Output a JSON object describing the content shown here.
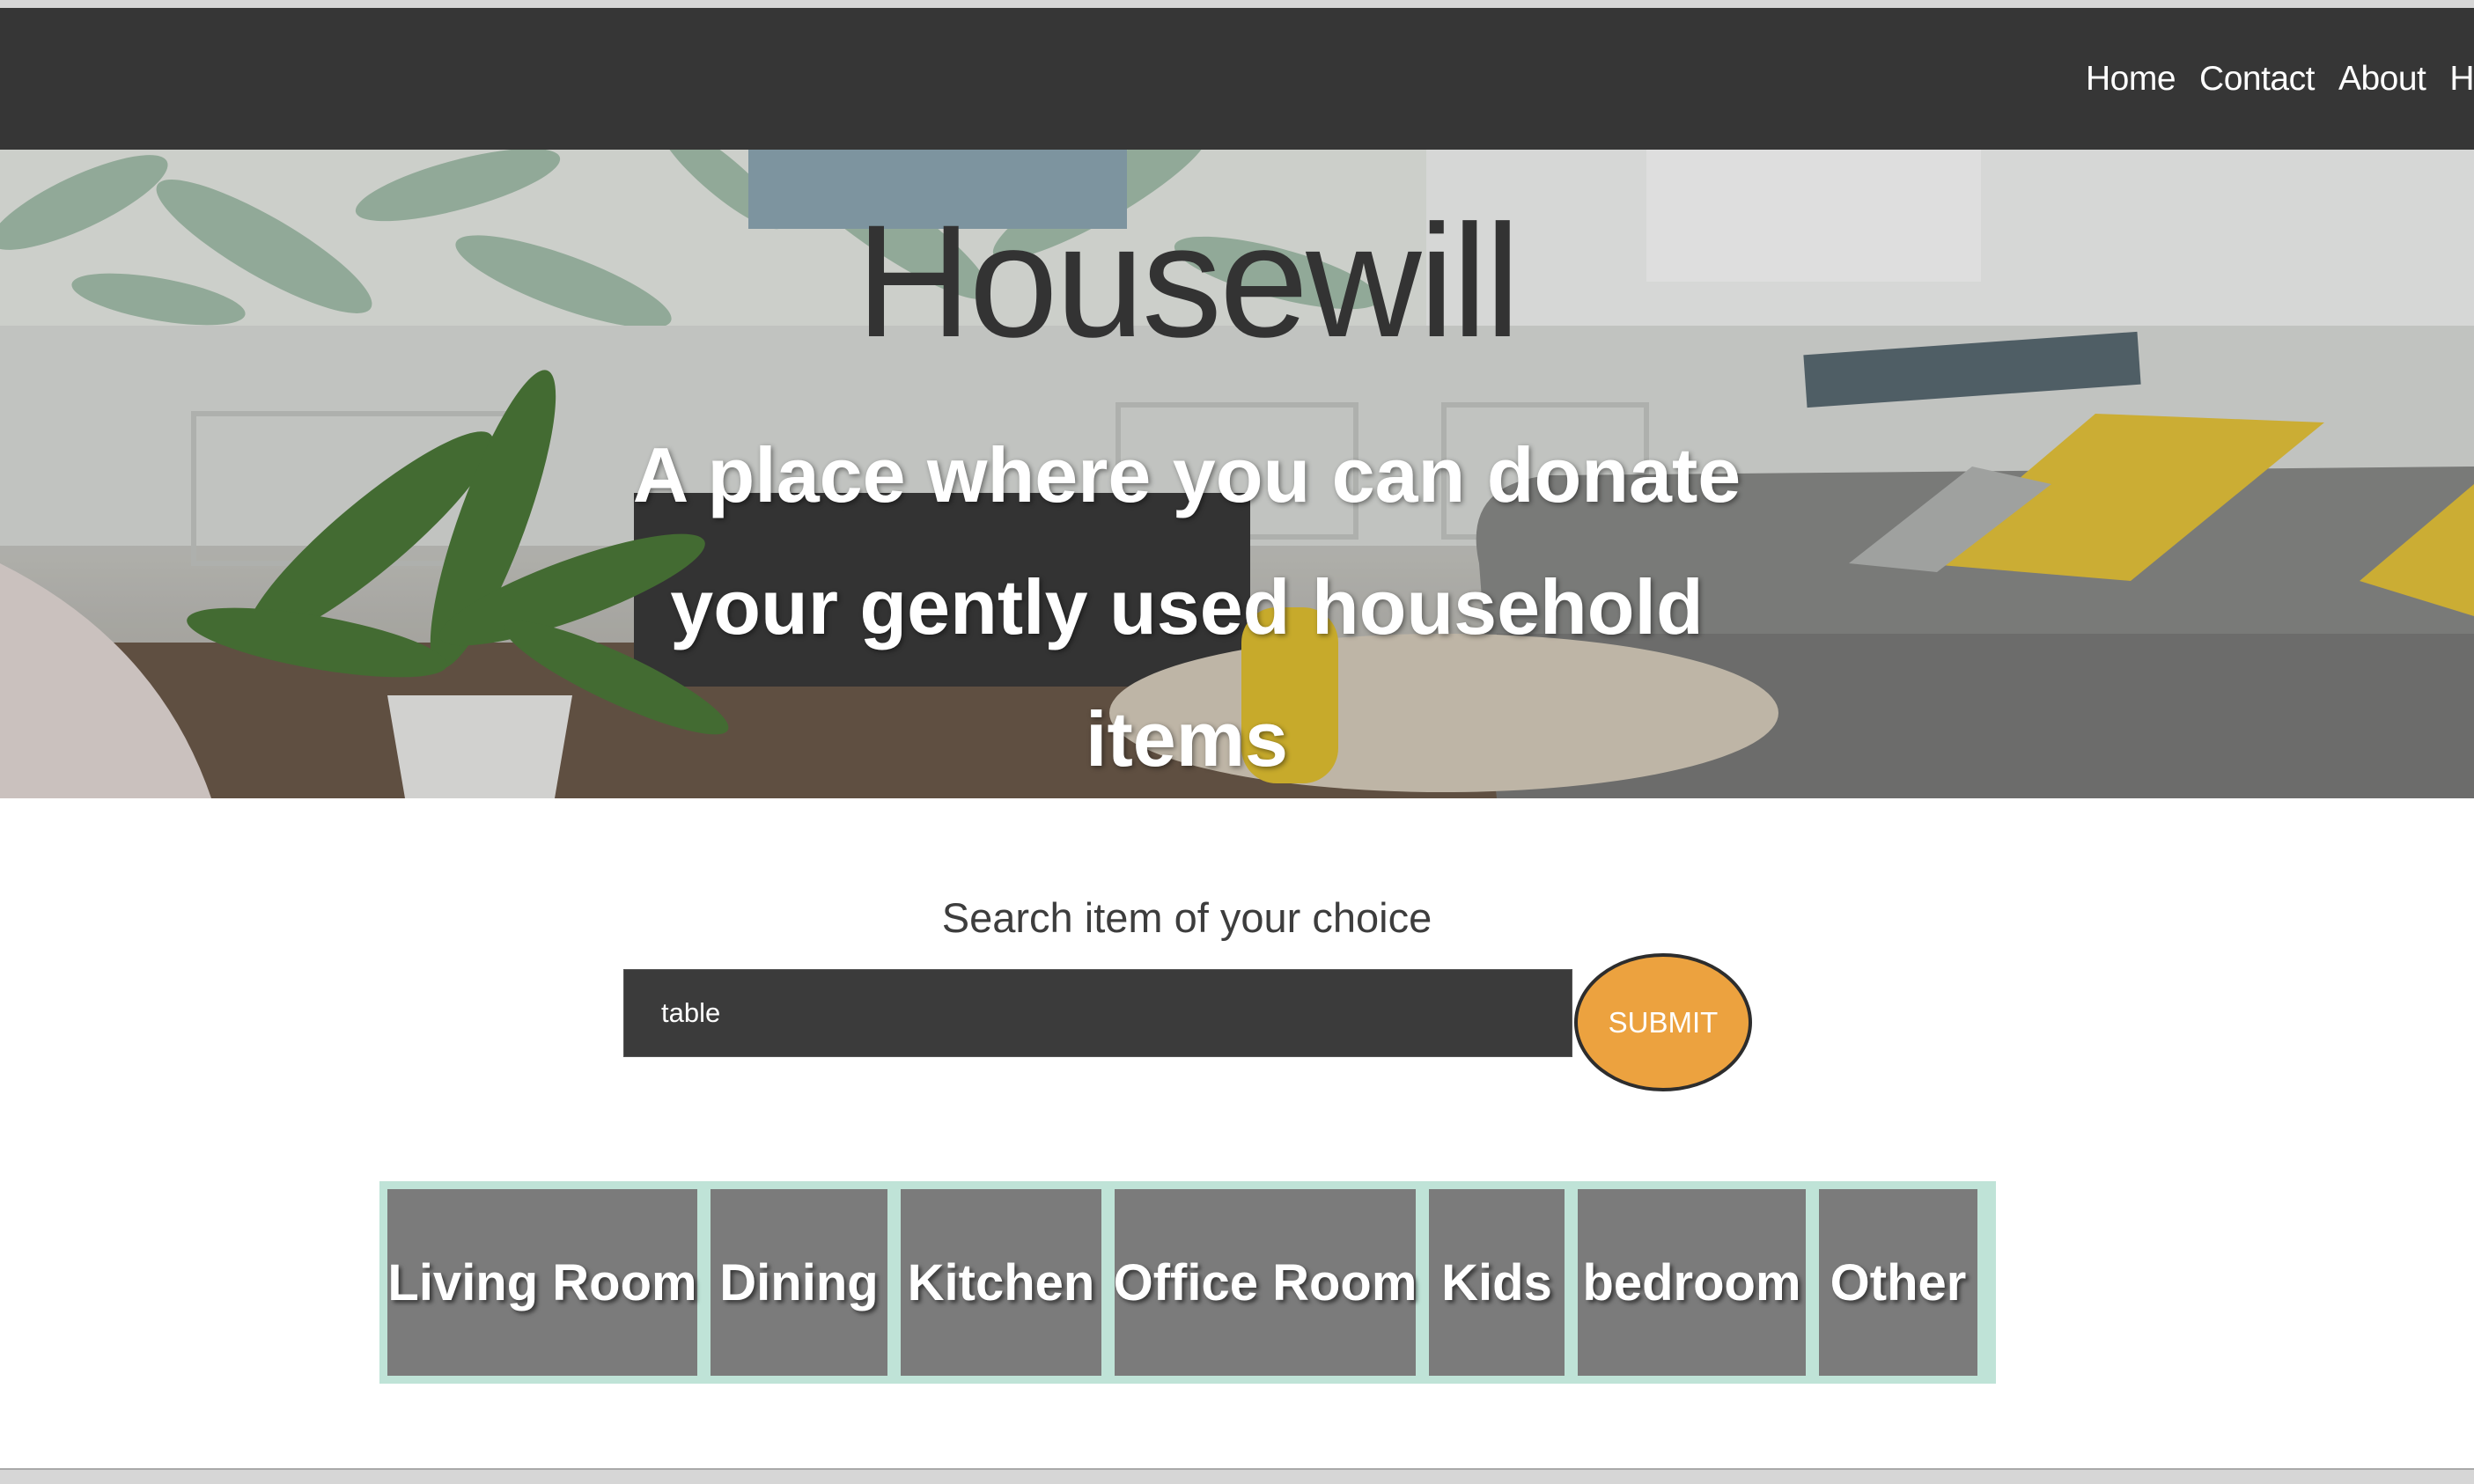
{
  "nav": {
    "links": [
      "Home",
      "Contact",
      "About",
      "Ho"
    ]
  },
  "hero": {
    "title": "Housewill",
    "subtitle": "A place where you can donate your gently used household items"
  },
  "search": {
    "label": "Search item of your choice",
    "value": "table",
    "submit_label": "SUBMIT"
  },
  "categories": [
    "Living Room",
    "Dining",
    "Kitchen",
    "Office Room",
    "Kids",
    "bedroom",
    "Other"
  ],
  "colors": {
    "navbar": "#363636",
    "submit": "#eca23f",
    "category_border": "#bfe3d7",
    "category_tile": "#7b7b7b"
  }
}
